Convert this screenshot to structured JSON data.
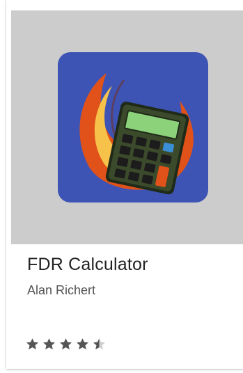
{
  "app": {
    "title": "FDR Calculator",
    "developer": "Alan Richert",
    "rating_stars": 4.5,
    "max_stars": 5,
    "icon": "calculator-with-flame-icon"
  },
  "colors": {
    "thumbnail_background": "#cccccc",
    "icon_background": "#3d54b5",
    "flame_outer": "#e0521a",
    "flame_inner": "#f6c24a",
    "calculator_body": "#3c4a2c",
    "calculator_screen": "#8bd27a",
    "star": "#555555"
  }
}
